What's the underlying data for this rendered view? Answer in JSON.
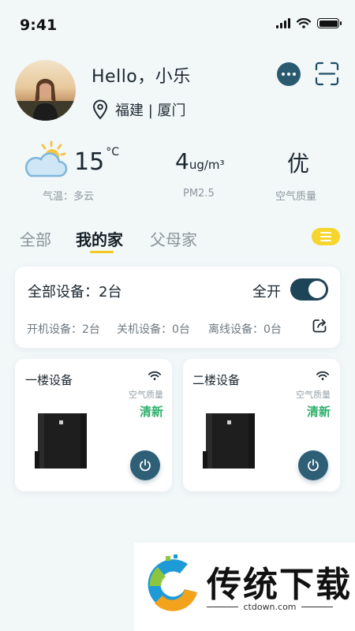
{
  "status_bar": {
    "time": "9:41"
  },
  "profile": {
    "greeting": "Hello，小乐",
    "location": "福建 | 厦门"
  },
  "weather": {
    "temperature": "15",
    "temperature_unit": "°C",
    "temperature_label": "气温：多云",
    "pm25_value": "4",
    "pm25_unit": "ug/m³",
    "pm25_label": "PM2.5",
    "air_quality_value": "优",
    "air_quality_label": "空气质量"
  },
  "tabs": [
    {
      "label": "全部",
      "active": false
    },
    {
      "label": "我的家",
      "active": true
    },
    {
      "label": "父母家",
      "active": false
    }
  ],
  "summary": {
    "total_label": "全部设备：2台",
    "all_on_label": "全开",
    "all_on": true,
    "online_label": "开机设备：2台",
    "off_label": "关机设备：0台",
    "offline_label": "离线设备：0台"
  },
  "devices": [
    {
      "name": "一楼设备",
      "aq_label": "空气质量",
      "aq_value": "清新"
    },
    {
      "name": "二楼设备",
      "aq_label": "空气质量",
      "aq_value": "清新"
    }
  ],
  "watermark": {
    "brand": "传统下载",
    "url": "ctdown.com"
  },
  "colors": {
    "accent": "#1d4557",
    "toggle_menu": "#f6d52e",
    "fresh": "#2cb06b"
  }
}
